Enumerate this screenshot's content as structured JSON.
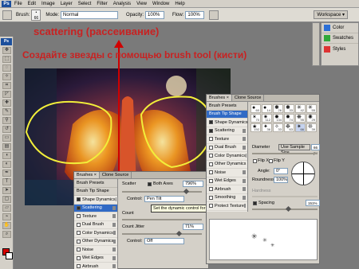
{
  "menubar": {
    "logo": "Ps",
    "items": [
      "File",
      "Edit",
      "Image",
      "Layer",
      "Select",
      "Filter",
      "Analysis",
      "View",
      "Window",
      "Help"
    ]
  },
  "options": {
    "brush_label": "Brush:",
    "brush_size": "66",
    "mode_label": "Mode:",
    "mode_value": "Normal",
    "opacity_label": "Opacity:",
    "opacity_value": "100%",
    "flow_label": "Flow:",
    "flow_value": "100%",
    "workspace": "Workspace ▾"
  },
  "dock": {
    "items": [
      {
        "label": "Color",
        "icon": "color-icon",
        "color": "#2c6fd6"
      },
      {
        "label": "Swatches",
        "icon": "swatches-icon",
        "color": "#2fa83a"
      },
      {
        "label": "Styles",
        "icon": "styles-icon",
        "color": "#d33"
      }
    ]
  },
  "annotation": {
    "heading": "scattering (рассеивание)",
    "instruction": "Создайте звезды с помощью brush tool (кисти)"
  },
  "brushes_scatter": {
    "tabs": [
      "Brushes ×",
      "Clone Source"
    ],
    "presets": "Brush Presets",
    "tip_shape": "Brush Tip Shape",
    "items": [
      {
        "label": "Shape Dynamics",
        "checked": true,
        "selected": false
      },
      {
        "label": "Scattering",
        "checked": true,
        "selected": true
      },
      {
        "label": "Texture",
        "checked": false,
        "selected": false
      },
      {
        "label": "Dual Brush",
        "checked": false,
        "selected": false
      },
      {
        "label": "Color Dynamics",
        "checked": false,
        "selected": false
      },
      {
        "label": "Other Dynamics",
        "checked": false,
        "selected": false
      },
      {
        "label": "Noise",
        "checked": false,
        "selected": false
      },
      {
        "label": "Wet Edges",
        "checked": false,
        "selected": false
      },
      {
        "label": "Airbrush",
        "checked": false,
        "selected": false
      },
      {
        "label": "Smoothing",
        "checked": false,
        "selected": false
      }
    ],
    "scatter_label": "Scatter",
    "both_axes": "Both Axes",
    "scatter_value": "796%",
    "scatter_level": 0.8,
    "control_label": "Control:",
    "control_value": "Pen Tilt",
    "tooltip": "Set the dynamic control for scatter",
    "count_label": "Count",
    "count_jitter_label": "Count Jitter",
    "count_jitter_value": "71%",
    "count_jitter_level": 0.71,
    "control2_value": "Off"
  },
  "brushes_tip": {
    "tabs": [
      "Brushes ×",
      "Clone Source"
    ],
    "presets": "Brush Presets",
    "items": [
      {
        "label": "Brush Tip Shape",
        "checked": false,
        "selected": true,
        "head": true
      },
      {
        "label": "Shape Dynamics",
        "checked": true,
        "selected": false
      },
      {
        "label": "Scattering",
        "checked": true,
        "selected": false
      },
      {
        "label": "Texture",
        "checked": false,
        "selected": false
      },
      {
        "label": "Dual Brush",
        "checked": false,
        "selected": false
      },
      {
        "label": "Color Dynamics",
        "checked": false,
        "selected": false
      },
      {
        "label": "Other Dynamics",
        "checked": false,
        "selected": false
      },
      {
        "label": "Noise",
        "checked": false,
        "selected": false
      },
      {
        "label": "Wet Edges",
        "checked": false,
        "selected": false
      },
      {
        "label": "Airbrush",
        "checked": false,
        "selected": false
      },
      {
        "label": "Smoothing",
        "checked": false,
        "selected": false
      },
      {
        "label": "Protect Texture",
        "checked": false,
        "selected": false
      }
    ],
    "tip_sizes": [
      "60",
      "14",
      "26",
      "33",
      "42",
      "55",
      "70",
      "112",
      "134",
      "74",
      "95",
      "29",
      "192",
      "36",
      "33",
      "63",
      "66",
      "39"
    ],
    "diameter_label": "Diameter",
    "use_sample_size": "Use Sample Size",
    "diameter_value": "66 px",
    "flip_x": "Flip X",
    "flip_y": "Flip Y",
    "angle_label": "Angle:",
    "angle_value": "0°",
    "roundness_label": "Roundness:",
    "roundness_value": "100%",
    "hardness_label": "Hardness",
    "spacing_label": "Spacing",
    "spacing_value": "151%",
    "spacing_level": 0.55
  }
}
